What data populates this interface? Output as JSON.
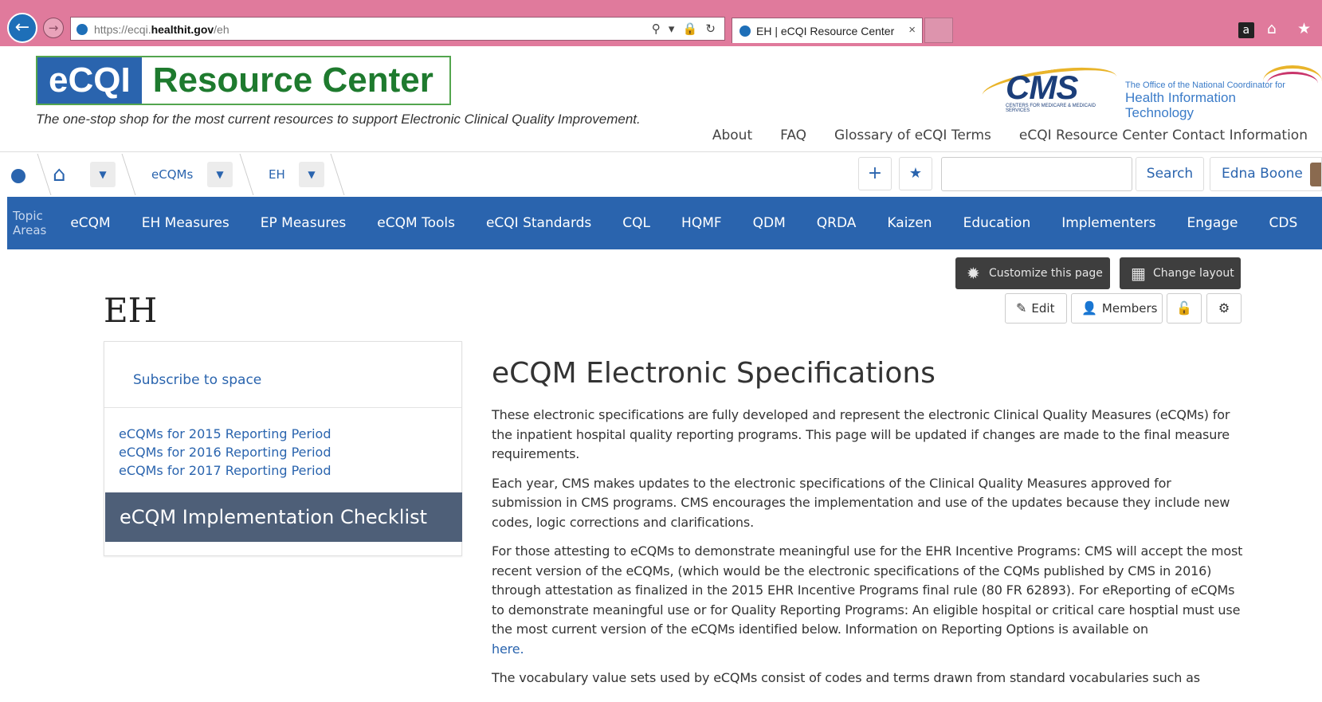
{
  "browser": {
    "url_prefix": "https://ecqi.",
    "url_host": "healthit.gov",
    "url_path": "/eh",
    "address_tools": "⚲ ▾ 🔒 ↻",
    "tab_title": "EH | eCQI Resource Center",
    "tab_close": "×",
    "back_glyph": "←",
    "forward_glyph": "→",
    "amazon_glyph": "a",
    "home_glyph": "⌂",
    "star_glyph": "★"
  },
  "header": {
    "logo_left": "eCQI",
    "logo_right": "Resource Center",
    "tagline": "The one-stop shop for the most current resources to support Electronic Clinical Quality Improvement.",
    "cms_word": "CMS",
    "cms_sub": "CENTERS FOR MEDICARE & MEDICAID SERVICES",
    "onc_line1": "The Office of the National Coordinator for",
    "onc_line2": "Health Information Technology",
    "nav": [
      "About",
      "FAQ",
      "Glossary of eCQI Terms",
      "eCQI Resource Center Contact Information"
    ]
  },
  "toolbar": {
    "breadcrumb": [
      "eCQMs",
      "EH"
    ],
    "add_glyph": "+",
    "favorite_glyph": "★",
    "search_placeholder": "",
    "search_label": "Search",
    "user_name": "Edna Boone"
  },
  "topic_bar": {
    "label": "Topic Areas",
    "items": [
      "eCQM",
      "EH Measures",
      "EP Measures",
      "eCQM Tools",
      "eCQI Standards",
      "CQL",
      "HQMF",
      "QDM",
      "QRDA",
      "Kaizen",
      "Education",
      "Implementers",
      "Engage",
      "CDS"
    ]
  },
  "page_tools": {
    "customize_label": "Customize this page",
    "layout_label": "Change layout",
    "edit_label": "Edit",
    "members_label": "Members"
  },
  "page_title": "EH",
  "left_panel": {
    "subscribe": "Subscribe to space",
    "links": [
      "eCQMs for 2015 Reporting Period",
      "eCQMs for 2016 Reporting Period",
      "eCQMs for 2017 Reporting Period"
    ],
    "checklist": "eCQM Implementation Checklist"
  },
  "main": {
    "heading": "eCQM Electronic Specifications",
    "p1": "These electronic specifications are fully developed and represent the electronic Clinical Quality Measures (eCQMs) for the inpatient hospital quality reporting programs. This page will be updated if changes are made to the final measure requirements.",
    "p2": "Each year, CMS makes updates to the electronic specifications of the Clinical Quality Measures approved for submission in CMS programs. CMS encourages the implementation and use of the updates because they include new codes, logic corrections and clarifications.",
    "p3": "For those attesting to eCQMs to demonstrate meaningful use for the EHR Incentive Programs: CMS will accept the most recent version of the eCQMs, (which would be the electronic specifications of the CQMs published by CMS in 2016) through attestation as finalized in the 2015 EHR Incentive Programs final rule (80 FR 62893).  For eReporting of eCQMs to demonstrate meaningful use or for Quality Reporting Programs: An eligible hospital or critical care hosptial must use the most current version of the eCQMs identified below. Information on Reporting Options is available on",
    "p3_link": "here.",
    "p4": "The vocabulary value sets used by eCQMs consist of codes and terms drawn from standard vocabularies such as"
  },
  "colors": {
    "chrome": "#e07a9c",
    "brand_blue": "#2a64ae",
    "brand_green": "#1e7a2e",
    "dark_button": "#3e3e3e",
    "checklist_bg": "#4e5f78"
  }
}
